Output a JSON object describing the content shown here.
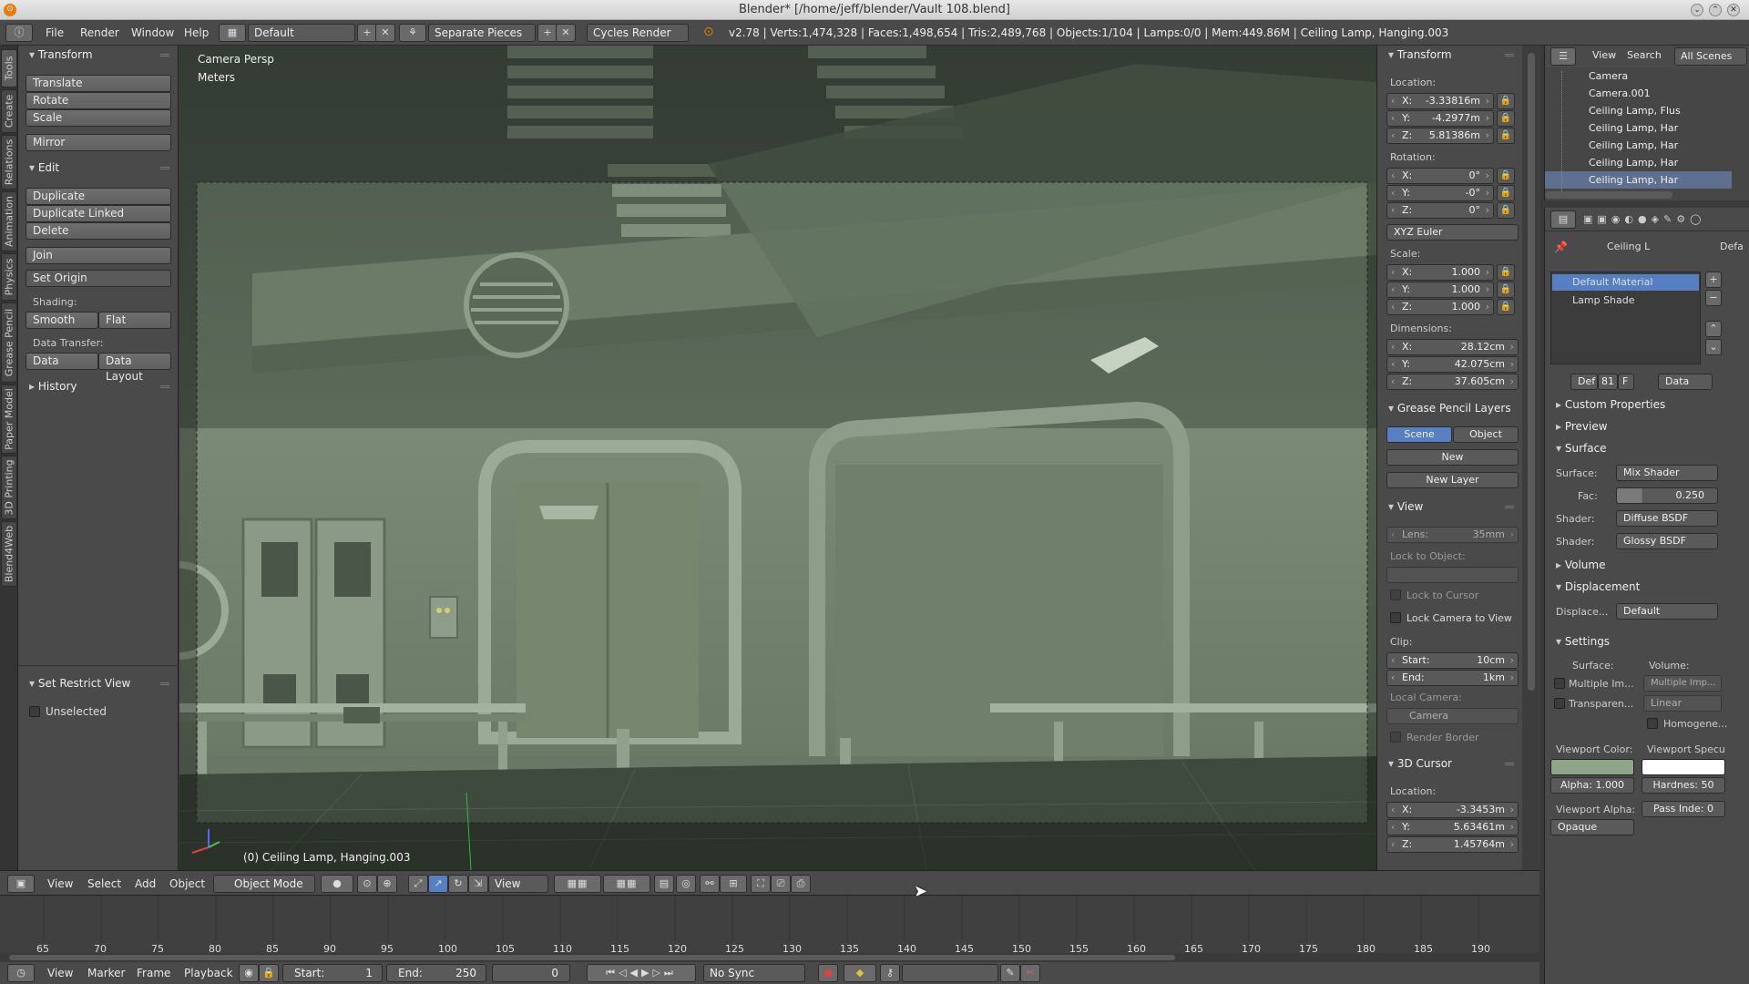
{
  "window": {
    "title": "Blender* [/home/jeff/blender/Vault 108.blend]"
  },
  "info": {
    "menus": [
      "File",
      "Render",
      "Window",
      "Help"
    ],
    "layout": "Default",
    "scene": "Separate Pieces",
    "engine": "Cycles Render",
    "stats": "v2.78 | Verts:1,474,328 | Faces:1,498,654 | Tris:2,489,768 | Objects:1/104 | Lamps:0/0 | Mem:449.86M | Ceiling Lamp, Hanging.003"
  },
  "vtabs": [
    "Tools",
    "Create",
    "Relations",
    "Animation",
    "Physics",
    "Grease Pencil",
    "Paper Model",
    "3D Printing",
    "Blend4Web"
  ],
  "tools": {
    "transform_title": "Transform",
    "translate": "Translate",
    "rotate": "Rotate",
    "scale": "Scale",
    "mirror": "Mirror",
    "edit_title": "Edit",
    "duplicate": "Duplicate",
    "duplicate_linked": "Duplicate Linked",
    "delete": "Delete",
    "join": "Join",
    "set_origin": "Set Origin",
    "shading_label": "Shading:",
    "smooth": "Smooth",
    "flat": "Flat",
    "data_transfer_label": "Data Transfer:",
    "data": "Data",
    "data_layout": "Data Layout",
    "history_title": "History",
    "restrict_title": "Set Restrict View",
    "unselected": "Unselected"
  },
  "viewport": {
    "view_name": "Camera Persp",
    "units": "Meters",
    "object_label": "(0) Ceiling Lamp, Hanging.003"
  },
  "vpheader": {
    "view": "View",
    "select": "Select",
    "add": "Add",
    "object": "Object",
    "mode": "Object Mode",
    "orientation": "View"
  },
  "npanel": {
    "transform_title": "Transform",
    "location_label": "Location:",
    "loc_x": "-3.33816m",
    "loc_y": "-4.2977m",
    "loc_z": "5.81386m",
    "rotation_label": "Rotation:",
    "rot_x": "0°",
    "rot_y": "-0°",
    "rot_z": "0°",
    "rotation_mode": "XYZ Euler",
    "scale_label": "Scale:",
    "scale_x": "1.000",
    "scale_y": "1.000",
    "scale_z": "1.000",
    "dimensions_label": "Dimensions:",
    "dim_x": "28.12cm",
    "dim_y": "42.075cm",
    "dim_z": "37.605cm",
    "gp_title": "Grease Pencil Layers",
    "gp_scene": "Scene",
    "gp_object": "Object",
    "gp_new": "New",
    "gp_new_layer": "New Layer",
    "view_title": "View",
    "lens": "Lens:",
    "lens_value": "35mm",
    "lock_to_object": "Lock to Object:",
    "lock_to_cursor": "Lock to Cursor",
    "lock_camera": "Lock Camera to View",
    "clip_label": "Clip:",
    "clip_start_label": "Start:",
    "clip_start": "10cm",
    "clip_end_label": "End:",
    "clip_end": "1km",
    "local_camera": "Local Camera:",
    "camera": "Camera",
    "render_border": "Render Border",
    "cursor_title": "3D Cursor",
    "cursor_location_label": "Location:",
    "cur_x": "-3.3453m",
    "cur_y": "5.63461m",
    "cur_z": "1.45764m"
  },
  "outliner": {
    "view": "View",
    "search": "Search",
    "scenes": "All Scenes",
    "rows": [
      "Camera",
      "Camera.001",
      "Ceiling Lamp, Flus",
      "Ceiling Lamp, Har",
      "Ceiling Lamp, Har",
      "Ceiling Lamp, Har",
      "Ceiling Lamp, Har"
    ]
  },
  "props": {
    "breadcrumb_object": "Ceiling L",
    "breadcrumb_mat": "Defa",
    "slots": [
      "Default Material",
      "Lamp Shade"
    ],
    "mat_name": "Def",
    "mat_users": "81",
    "mat_fake": "F",
    "link": "Data",
    "custom_props": "Custom Properties",
    "preview": "Preview",
    "surface_title": "Surface",
    "surface_label": "Surface:",
    "surface_value": "Mix Shader",
    "fac_label": "Fac:",
    "fac_value": "0.250",
    "shader_label1": "Shader:",
    "shader1": "Diffuse BSDF",
    "shader_label2": "Shader:",
    "shader2": "Glossy BSDF",
    "volume": "Volume",
    "displacement": "Displacement",
    "displace_label": "Displace...",
    "displace_value": "Default",
    "settings": "Settings",
    "surface_sub": "Surface:",
    "volume_sub": "Volume:",
    "multiple_im": "Multiple Im...",
    "multiple_imp": "Multiple Imp...",
    "transparen": "Transparen...",
    "linear": "Linear",
    "homogene": "Homogene...",
    "vp_color": "Viewport Color:",
    "vp_spec": "Viewport Specu",
    "alpha": "Alpha: 1.000",
    "hardness": "Hardnes: 50",
    "vp_alpha": "Viewport Alpha:",
    "pass_index": "Pass Inde: 0",
    "opaque": "Opaque",
    "color_diffuse": "#8fa58a",
    "color_spec": "#ffffff"
  },
  "timeline": {
    "ticks": [
      "65",
      "70",
      "75",
      "80",
      "85",
      "90",
      "95",
      "100",
      "105",
      "110",
      "115",
      "120",
      "125",
      "130",
      "135",
      "140",
      "145",
      "150",
      "155",
      "160",
      "165",
      "170",
      "175",
      "180",
      "185",
      "190"
    ],
    "view": "View",
    "marker": "Marker",
    "frame": "Frame",
    "playback": "Playback",
    "start_label": "Start:",
    "start": "1",
    "end_label": "End:",
    "end": "250",
    "current": "0",
    "sync": "No Sync"
  }
}
